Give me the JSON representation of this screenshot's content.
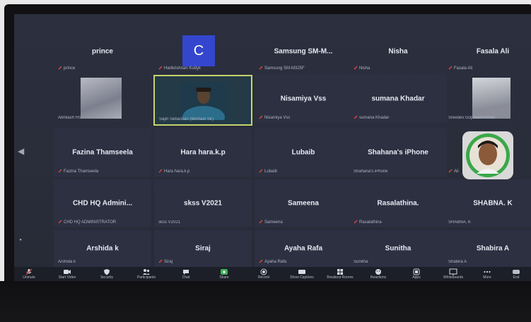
{
  "meeting": {
    "top_row": [
      {
        "name": "prince",
        "sub": "prince"
      },
      {
        "name": "",
        "sub": "Harikrishnan Kuttyk",
        "avatar_letter": "C"
      },
      {
        "name": "Samsung SM-M...",
        "sub": "Samsung SM-M325F"
      },
      {
        "name": "Nisha",
        "sub": "Nisha"
      },
      {
        "name": "Fasala Ali",
        "sub": "Fasala Ali"
      }
    ],
    "row2": [
      {
        "name": "",
        "sub": "Abhilash HS"
      },
      {
        "name": "",
        "sub": "Sajin Sebastian (Michael Sir)"
      },
      {
        "name": "Nisamiya Vss",
        "sub": "Nisamiya Vss"
      },
      {
        "name": "sumana Khadar",
        "sub": "sumana Khadar"
      },
      {
        "name": "",
        "sub": "Sreedev Gopalakrishnan"
      }
    ],
    "row3": [
      {
        "name": "Fazina Thamseela",
        "sub": "Fazina Thamseela"
      },
      {
        "name": "Hara hara.k.p",
        "sub": "Hara hara.k.p"
      },
      {
        "name": "Lubaib",
        "sub": "Lubaib"
      },
      {
        "name": "Shahana's iPhone",
        "sub": "Shahana's iPhone"
      },
      {
        "name": "",
        "sub": "Ali"
      }
    ],
    "row4": [
      {
        "name": "CHD HQ Admini...",
        "sub": "CHD HQ ADMINISTRATOR"
      },
      {
        "name": "skss V2021",
        "sub": "skss V2021"
      },
      {
        "name": "Sameena",
        "sub": "Sameena"
      },
      {
        "name": "Rasalathina.",
        "sub": "Rasalathina"
      },
      {
        "name": "SHABNA. K",
        "sub": "SHABNA. K"
      }
    ],
    "row5": [
      {
        "name": "Arshida k",
        "sub": "Arshida k"
      },
      {
        "name": "Siraj",
        "sub": "Siraj"
      },
      {
        "name": "Ayaha Rafa",
        "sub": "Ayaha Rafa"
      },
      {
        "name": "Sunitha",
        "sub": "Sunitha"
      },
      {
        "name": "Shabira A",
        "sub": "Shabira A"
      }
    ]
  },
  "toolbar": {
    "items": [
      {
        "label": "Unmute",
        "icon": "mic-icon"
      },
      {
        "label": "Start Video",
        "icon": "video-icon"
      },
      {
        "label": "Security",
        "icon": "shield-icon"
      },
      {
        "label": "Participants",
        "icon": "participants-icon"
      },
      {
        "label": "Chat",
        "icon": "chat-icon"
      },
      {
        "label": "Share",
        "icon": "share-icon"
      },
      {
        "label": "Record",
        "icon": "record-icon"
      },
      {
        "label": "Show Captions",
        "icon": "cc-icon"
      },
      {
        "label": "Breakout Rooms",
        "icon": "breakout-icon"
      },
      {
        "label": "Reactions",
        "icon": "reaction-icon"
      },
      {
        "label": "Apps",
        "icon": "apps-icon"
      },
      {
        "label": "Whiteboards",
        "icon": "whiteboard-icon"
      },
      {
        "label": "More",
        "icon": "more-icon"
      }
    ],
    "end_label": "End"
  },
  "colors": {
    "tile_bg": "#2c3041",
    "active_border": "#c7d36b",
    "avatar_blue": "#3446ce",
    "mic_muted": "#e0483e"
  }
}
